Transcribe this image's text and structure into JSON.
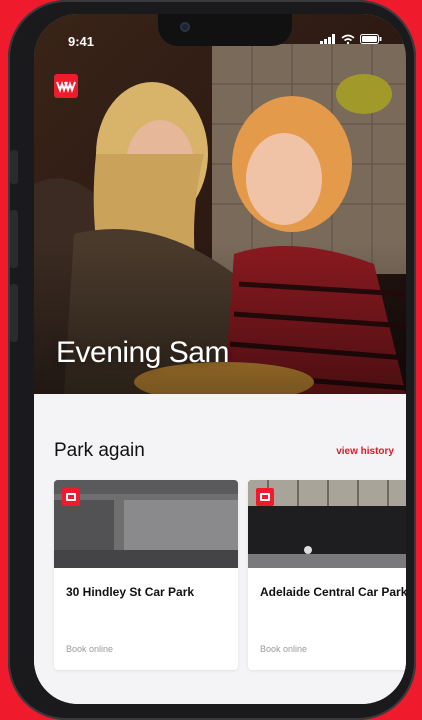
{
  "status_bar": {
    "time": "9:41"
  },
  "hero": {
    "greeting": "Evening Sam"
  },
  "park_again": {
    "title": "Park again",
    "view_history_label": "view history",
    "cards": [
      {
        "name": "30 Hindley St Car Park",
        "action": "Book online"
      },
      {
        "name": "Adelaide Central Car Park",
        "action": "Book online"
      }
    ]
  },
  "colors": {
    "brand_red": "#ef1b2d",
    "link_red": "#e0182b"
  }
}
